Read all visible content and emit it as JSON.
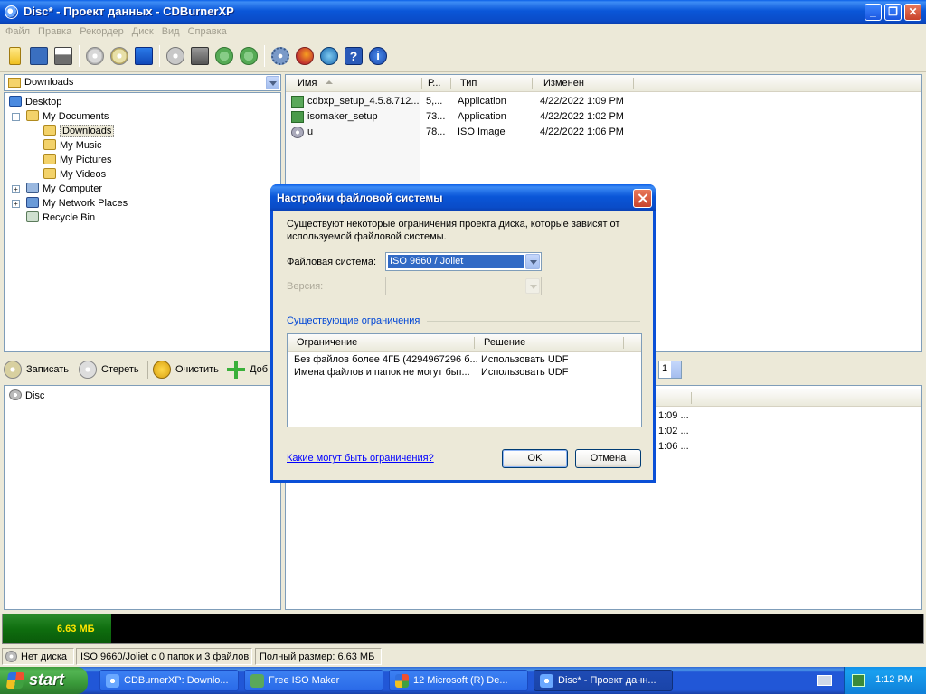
{
  "window": {
    "title": "Disc* - Проект данных - CDBurnerXP",
    "minimize": "_",
    "restore": "❐",
    "close": "✕"
  },
  "menu": [
    "Файл",
    "Правка",
    "Рекордер",
    "Диск",
    "Вид",
    "Справка"
  ],
  "toolbar_icons": [
    "new-icon",
    "save-icon",
    "print-icon",
    "erase-disc-icon",
    "burn-disc-icon",
    "disc-blue-icon",
    "copy-disc-icon",
    "drive-info-icon",
    "refresh-icon",
    "forward-icon",
    "settings-icon",
    "web-icon",
    "update-icon",
    "help-icon",
    "info-icon"
  ],
  "explorer": {
    "location": "Downloads",
    "tree": [
      {
        "label": "Desktop",
        "icon": "desktop-icon"
      },
      {
        "label": "My Documents",
        "icon": "folder-icon"
      },
      {
        "label": "Downloads",
        "icon": "folder-icon",
        "selected": true
      },
      {
        "label": "My Music",
        "icon": "music-folder-icon"
      },
      {
        "label": "My Pictures",
        "icon": "pictures-folder-icon"
      },
      {
        "label": "My Videos",
        "icon": "videos-folder-icon"
      },
      {
        "label": "My Computer",
        "icon": "computer-icon"
      },
      {
        "label": "My Network Places",
        "icon": "network-icon"
      },
      {
        "label": "Recycle Bin",
        "icon": "recycle-bin-icon"
      }
    ]
  },
  "files": {
    "columns": [
      "Имя",
      "Р...",
      "Тип",
      "Изменен"
    ],
    "rows": [
      {
        "name": "cdbxp_setup_4.5.8.712...",
        "size": "5,...",
        "type": "Application",
        "modified": "4/22/2022 1:09 PM"
      },
      {
        "name": "isomaker_setup",
        "size": "73...",
        "type": "Application",
        "modified": "4/22/2022 1:02 PM"
      },
      {
        "name": "u",
        "size": "78...",
        "type": "ISO Image",
        "modified": "4/22/2022 1:06 PM"
      }
    ]
  },
  "compilation_toolbar": {
    "burn": "Записать",
    "erase": "Стереть",
    "clear": "Очистить",
    "add": "Доб",
    "copies": "1"
  },
  "compilation": {
    "root": "Disc",
    "times": [
      "1:09 ...",
      "1:02 ...",
      "1:06 ..."
    ]
  },
  "capacity": {
    "used_label": "6.63 МБ",
    "fill_fraction": 0.118
  },
  "status": {
    "drive": "Нет диска",
    "fs_info": "ISO 9660/Joliet с 0 папок и 3 файлов",
    "total": "Полный размер: 6.63 МБ"
  },
  "dialog": {
    "title": "Настройки файловой системы",
    "description": "Существуют некоторые ограничения проекта диска, которые зависят от используемой файловой системы.",
    "fs_label": "Файловая система:",
    "fs_value": "ISO 9660 / Joliet",
    "version_label": "Версия:",
    "group_label": "Существующие ограничения",
    "columns": [
      "Ограничение",
      "Решение"
    ],
    "rows": [
      {
        "restriction": "Без файлов более 4ГБ (4294967296 б...",
        "solution": "Использовать UDF"
      },
      {
        "restriction": "Имена файлов и папок не могут быт...",
        "solution": "Использовать UDF"
      }
    ],
    "link": "Какие могут быть ограничения?",
    "ok": "OK",
    "cancel": "Отмена"
  },
  "taskbar": {
    "start": "start",
    "tasks": [
      {
        "label": "CDBurnerXP: Downlo...",
        "icon": "cdburnerxp-icon"
      },
      {
        "label": "Free ISO Maker",
        "icon": "isomaker-icon"
      },
      {
        "label": "12 Microsoft (R) De...",
        "icon": "group-icon"
      },
      {
        "label": "Disc* - Проект данн...",
        "icon": "cdburnerxp-icon",
        "active": true
      }
    ],
    "clock": "1:12 PM"
  }
}
